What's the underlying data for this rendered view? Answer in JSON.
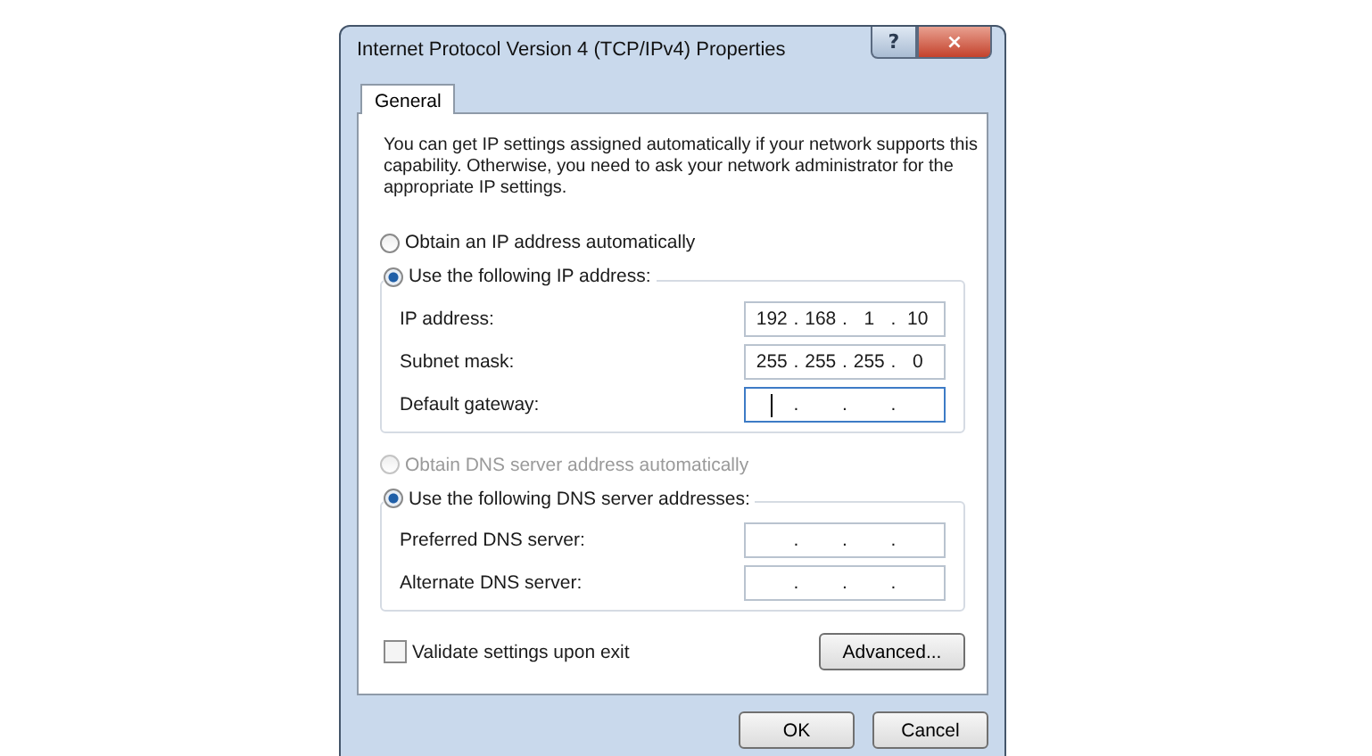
{
  "window": {
    "title": "Internet Protocol Version 4 (TCP/IPv4) Properties",
    "help": "?",
    "close": "×"
  },
  "tabs": [
    {
      "label": "General",
      "selected": true
    }
  ],
  "description": "You can get IP settings assigned automatically if your network supports this capability. Otherwise, you need to ask your network administrator for the appropriate IP settings.",
  "ip": {
    "auto": {
      "label": "Obtain an IP address automatically",
      "selected": false,
      "disabled": false
    },
    "manual": {
      "label": "Use the following IP address:",
      "selected": true,
      "disabled": false
    },
    "fields": [
      {
        "label": "IP address:",
        "segments": [
          "192",
          ".",
          "168",
          ".",
          "1",
          ".",
          "10"
        ],
        "focused": false
      },
      {
        "label": "Subnet mask:",
        "segments": [
          "255",
          ".",
          "255",
          ".",
          "255",
          ".",
          "0"
        ],
        "focused": false
      },
      {
        "label": "Default gateway:",
        "segments": [
          ".",
          ".",
          "."
        ],
        "focused": true
      }
    ]
  },
  "dns": {
    "auto": {
      "label": "Obtain DNS server address automatically",
      "selected": false,
      "disabled": true
    },
    "manual": {
      "label": "Use the following DNS server addresses:",
      "selected": true,
      "disabled": false
    },
    "fields": [
      {
        "label": "Preferred DNS server:",
        "segments": [
          ".",
          ".",
          "."
        ],
        "focused": false
      },
      {
        "label": "Alternate DNS server:",
        "segments": [
          ".",
          ".",
          "."
        ],
        "focused": false
      }
    ]
  },
  "validate": {
    "label": "Validate settings upon exit",
    "checked": false
  },
  "advanced": "Advanced...",
  "buttons": [
    "OK",
    "Cancel"
  ]
}
